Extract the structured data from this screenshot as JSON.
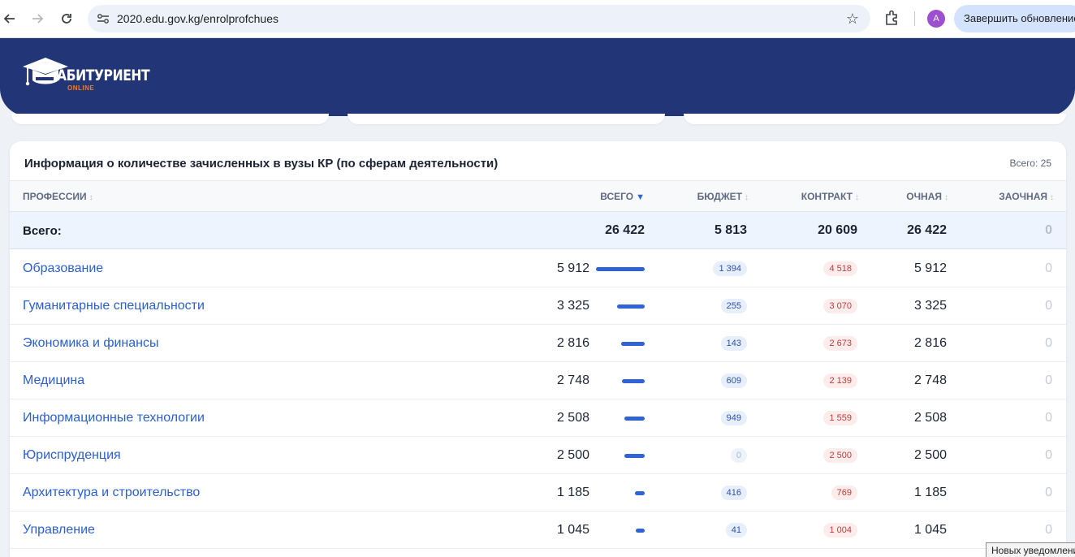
{
  "browser": {
    "url": "2020.edu.gov.kg/enrolprofchues",
    "avatar_letter": "A",
    "update_label": "Завершить обновление"
  },
  "site": {
    "logo_text": "АБИТУРИЕНТ",
    "logo_sub": "ONLINE",
    "brand_color": "#223577"
  },
  "table": {
    "title": "Информация о количестве зачисленных в вузы КР (по сферам деятельности)",
    "count_label": "Всего: 25",
    "headers": {
      "profession": "ПРОФЕССИИ",
      "all": "ВСЕГО",
      "budget": "БЮДЖЕТ",
      "contract": "КОНТРАКТ",
      "fulltime": "ОЧНАЯ",
      "parttime": "ЗАОЧНАЯ"
    },
    "sort_active": "▼",
    "sort_idle": "↕",
    "total": {
      "name": "Всего:",
      "all": "26 422",
      "budget": "5 813",
      "contract": "20 609",
      "fulltime": "26 422",
      "parttime": "0"
    },
    "rows": [
      {
        "name": "Образование",
        "all": "5 912",
        "bar": 1.0,
        "budget": "1 394",
        "contract": "4 518",
        "fulltime": "5 912",
        "parttime": "0"
      },
      {
        "name": "Гуманитарные специальности",
        "all": "3 325",
        "bar": 0.562,
        "budget": "255",
        "contract": "3 070",
        "fulltime": "3 325",
        "parttime": "0"
      },
      {
        "name": "Экономика и финансы",
        "all": "2 816",
        "bar": 0.476,
        "budget": "143",
        "contract": "2 673",
        "fulltime": "2 816",
        "parttime": "0"
      },
      {
        "name": "Медицина",
        "all": "2 748",
        "bar": 0.465,
        "budget": "609",
        "contract": "2 139",
        "fulltime": "2 748",
        "parttime": "0"
      },
      {
        "name": "Информационные технологии",
        "all": "2 508",
        "bar": 0.424,
        "budget": "949",
        "contract": "1 559",
        "fulltime": "2 508",
        "parttime": "0"
      },
      {
        "name": "Юриспруденция",
        "all": "2 500",
        "bar": 0.423,
        "budget": "0",
        "contract": "2 500",
        "fulltime": "2 500",
        "parttime": "0"
      },
      {
        "name": "Архитектура и строительство",
        "all": "1 185",
        "bar": 0.2,
        "budget": "416",
        "contract": "769",
        "fulltime": "1 185",
        "parttime": "0"
      },
      {
        "name": "Управление",
        "all": "1 045",
        "bar": 0.177,
        "budget": "41",
        "contract": "1 004",
        "fulltime": "1 045",
        "parttime": "0"
      }
    ]
  },
  "toast": "Новых уведомлений"
}
